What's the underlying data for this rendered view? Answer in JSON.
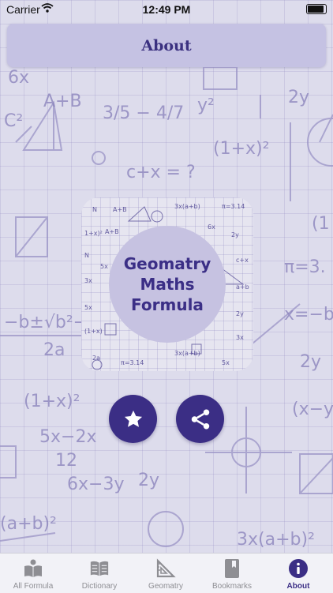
{
  "status_bar": {
    "carrier": "Carrier",
    "time": "12:49 PM"
  },
  "header": {
    "title": "About"
  },
  "logo": {
    "lines": [
      "Geomatry",
      "Maths",
      "Formula"
    ]
  },
  "actions": {
    "favorite": {
      "icon": "star-icon"
    },
    "share": {
      "icon": "share-icon"
    }
  },
  "tabs": [
    {
      "label": "All Formula",
      "icon": "book-icon"
    },
    {
      "label": "Dictionary",
      "icon": "dictionary-icon"
    },
    {
      "label": "Geomatry",
      "icon": "set-square-icon"
    },
    {
      "label": "Bookmarks",
      "icon": "bookmark-icon"
    },
    {
      "label": "About",
      "icon": "info-icon",
      "active": true
    }
  ],
  "colors": {
    "accent": "#3b2e85",
    "background": "#dddcec",
    "header": "#c5c2e3"
  }
}
